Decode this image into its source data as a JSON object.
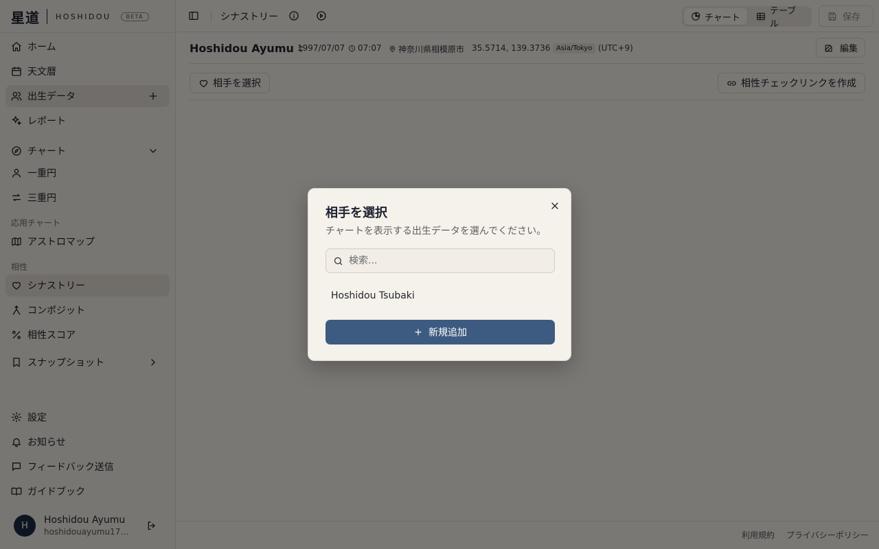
{
  "brand": {
    "kanji": "星道",
    "latin": "HOSHIDOU",
    "badge": "BETA"
  },
  "sidebar": {
    "items": [
      {
        "label": "ホーム",
        "icon": "home-icon"
      },
      {
        "label": "天文暦",
        "icon": "calendar-icon"
      },
      {
        "label": "出生データ",
        "icon": "users-icon",
        "active": true
      },
      {
        "label": "レポート",
        "icon": "sparkles-icon"
      }
    ],
    "chart_group": {
      "label": "チャート",
      "icon": "compass-icon"
    },
    "chart_items": [
      {
        "label": "一重円",
        "icon": "user-icon"
      },
      {
        "label": "三重円",
        "icon": "arrows-icon"
      }
    ],
    "applied_label": "応用チャート",
    "applied_items": [
      {
        "label": "アストロマップ",
        "icon": "map-icon"
      }
    ],
    "compat_label": "相性",
    "compat_items": [
      {
        "label": "シナストリー",
        "icon": "heart-icon",
        "active": true
      },
      {
        "label": "コンポジット",
        "icon": "merge-icon"
      },
      {
        "label": "相性スコア",
        "icon": "percent-icon"
      }
    ],
    "snapshot": {
      "label": "スナップショット",
      "icon": "bookmark-icon"
    },
    "bottom_items": [
      {
        "label": "設定",
        "icon": "gear-icon"
      },
      {
        "label": "お知らせ",
        "icon": "bell-icon"
      },
      {
        "label": "フィードバック送信",
        "icon": "message-icon"
      },
      {
        "label": "ガイドブック",
        "icon": "book-icon"
      }
    ],
    "user": {
      "initial": "H",
      "name": "Hoshidou Ayumu",
      "email": "hoshidouayumu1781..."
    }
  },
  "topbar": {
    "title": "シナストリー",
    "view_tabs": [
      {
        "label": "チャート",
        "active": true
      },
      {
        "label": "テーブル",
        "active": false
      }
    ],
    "save_label": "保存"
  },
  "info": {
    "name": "Hoshidou Ayumu",
    "date": "1997/07/07",
    "time": "07:07",
    "place": "神奈川県相模原市",
    "coords": "35.5714, 139.3736",
    "timezone": "Asia/Tokyo",
    "offset": "(UTC+9)",
    "edit_label": "編集"
  },
  "actions": {
    "select_partner": "相手を選択",
    "create_link": "相性チェックリンクを作成"
  },
  "footer": {
    "terms": "利用規約",
    "privacy": "プライバシーポリシー"
  },
  "modal": {
    "title": "相手を選択",
    "description": "チャートを表示する出生データを選んでください。",
    "search_placeholder": "検索...",
    "search_value": "",
    "items": [
      "Hoshidou Tsubaki"
    ],
    "add_button": "新規追加"
  }
}
